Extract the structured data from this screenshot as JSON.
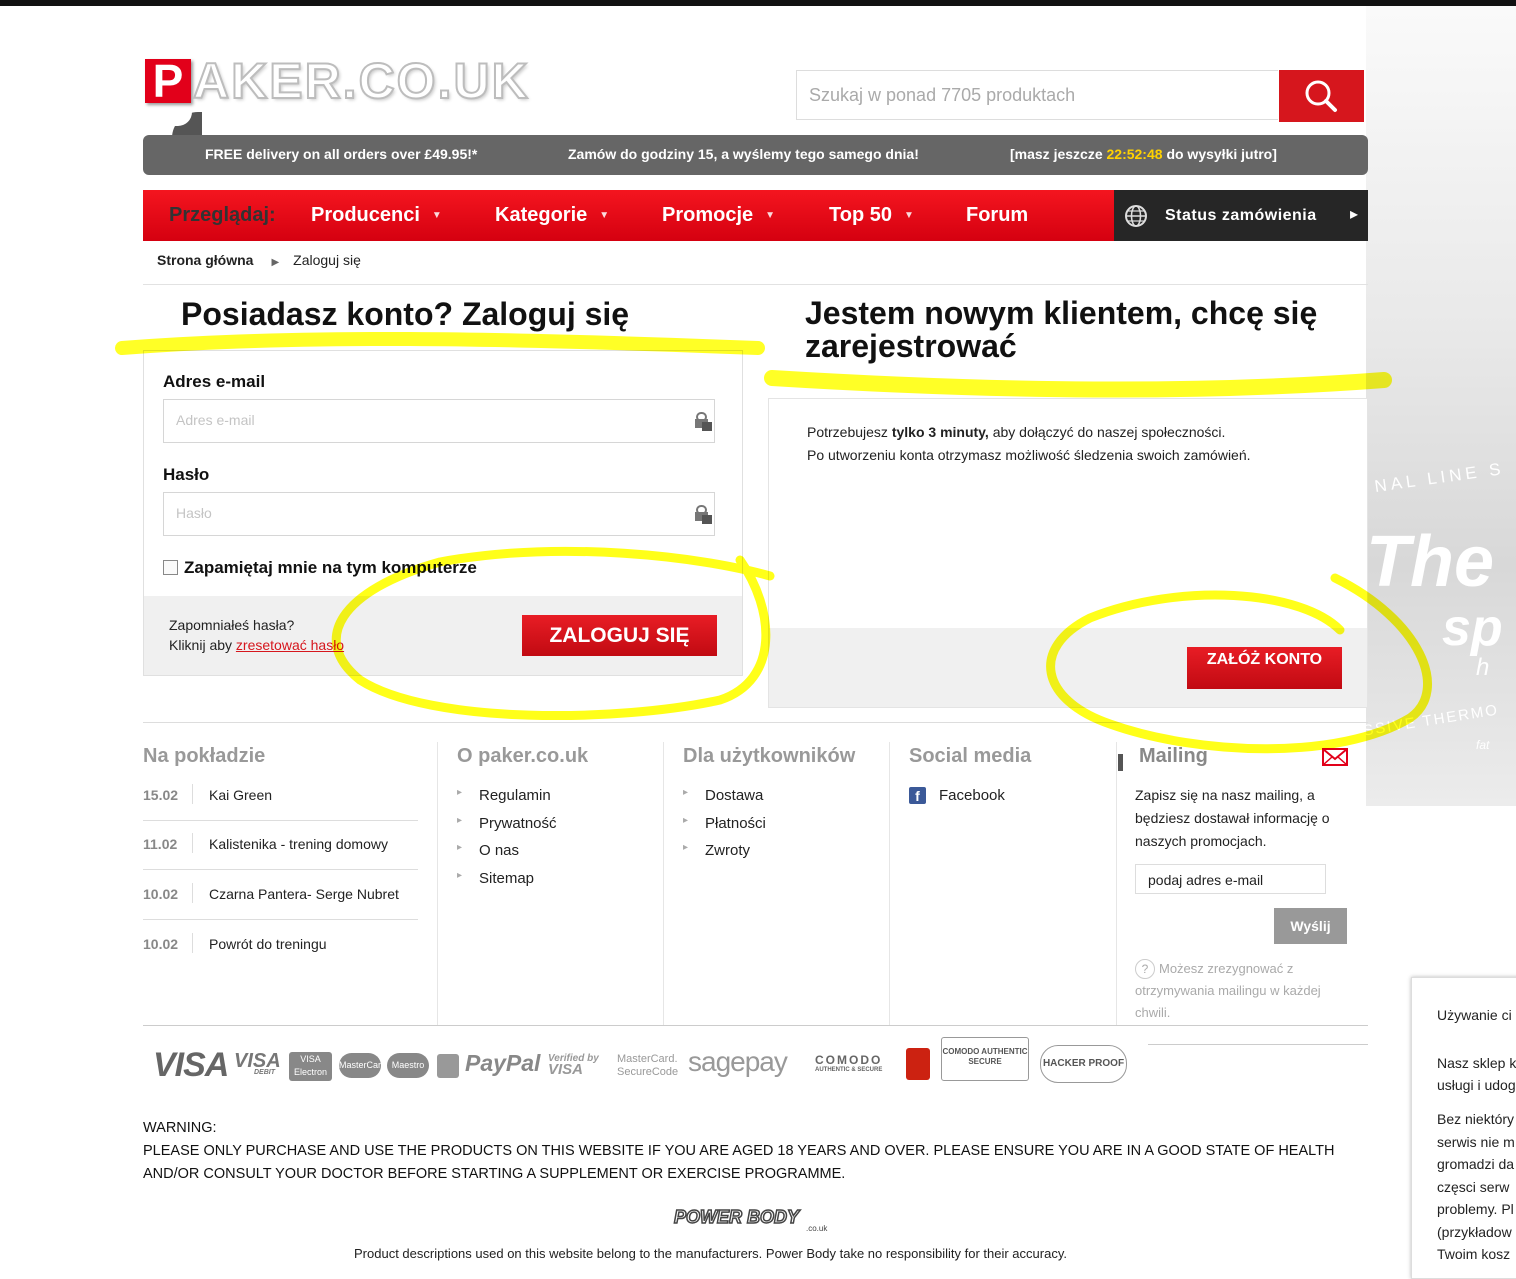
{
  "brand": {
    "logo_initial": "P",
    "logo_rest": "AKER.CO.UK"
  },
  "search": {
    "placeholder": "Szukaj w ponad 7705 produktach",
    "button_icon": "search-icon"
  },
  "infobar": {
    "delivery": "FREE delivery on all orders over £49.95!*",
    "same_day": "Zamów do godziny 15, a wyślemy tego samego dnia!",
    "countdown_prefix": "[masz jeszcze",
    "countdown": "22:52:48",
    "countdown_suffix": "do wysyłki jutro]"
  },
  "nav": {
    "browse": "Przeglądaj:",
    "items": [
      "Producenci",
      "Kategorie",
      "Promocje",
      "Top 50",
      "Forum"
    ],
    "status_label": "Status zamówienia",
    "colors": {
      "nav_red": "#e2001a",
      "status_bg": "#262626"
    }
  },
  "breadcrumb": {
    "home": "Strona główna",
    "current": "Zaloguj się"
  },
  "login": {
    "heading": "Posiadasz konto? Zaloguj się",
    "email_label": "Adres e-mail",
    "email_placeholder": "Adres e-mail",
    "password_label": "Hasło",
    "password_placeholder": "Hasło",
    "remember": "Zapamiętaj mnie na tym komputerze",
    "forgot_line1": "Zapomniałeś hasła?",
    "forgot_line2_prefix": "Kliknij aby",
    "forgot_link": "zresetować hasło",
    "submit": "ZALOGUJ SIĘ"
  },
  "register": {
    "heading": "Jestem nowym klientem, chcę się zarejestrować",
    "line1_prefix": "Potrzebujesz",
    "line1_bold": "tylko 3 minuty,",
    "line1_suffix": "aby dołączyć do naszej społeczności.",
    "line2": "Po utworzeniu konta otrzymasz możliwość śledzenia swoich zamówień.",
    "submit": "ZAŁÓŻ KONTO"
  },
  "footer": {
    "col1": {
      "title": "Na pokładzie",
      "news": [
        {
          "date": "15.02",
          "title": "Kai Green"
        },
        {
          "date": "11.02",
          "title": "Kalistenika - trening domowy"
        },
        {
          "date": "10.02",
          "title": "Czarna Pantera- Serge Nubret"
        },
        {
          "date": "10.02",
          "title": "Powrót do treningu"
        }
      ]
    },
    "col2": {
      "title": "O paker.co.uk",
      "links": [
        "Regulamin",
        "Prywatność",
        "O nas",
        "Sitemap"
      ]
    },
    "col3": {
      "title": "Dla użytkowników",
      "links": [
        "Dostawa",
        "Płatności",
        "Zwroty"
      ]
    },
    "col4": {
      "title": "Social media",
      "links": [
        "Facebook"
      ]
    },
    "mailing": {
      "title": "Mailing",
      "text": "Zapisz się na nasz mailing, a będziesz dostawał informację o naszych promocjach.",
      "input_value": "podaj adres e-mail",
      "send": "Wyślij",
      "note": "Możesz zrezygnować z otrzymywania mailingu w każdej chwili."
    }
  },
  "payments": {
    "visa": "VISA",
    "visa_debit": "VISA",
    "visa_debit_sub": "DEBIT",
    "visa_electron": "VISA Electron",
    "mastercard": "MasterCard",
    "maestro": "Maestro",
    "paypal": "PayPal",
    "verified_by": "Verified by",
    "verified_visa": "VISA",
    "mc_secure": "MasterCard. SecureCode",
    "sagepay": "sagepay",
    "comodo": "COMODO",
    "comodo_sub": "AUTHENTIC & SECURE",
    "comodo_badge": "COMODO AUTHENTIC SECURE",
    "hacker_proof": "HACKER PROOF"
  },
  "warning": {
    "label": "WARNING:",
    "text": "PLEASE ONLY PURCHASE AND USE THE PRODUCTS ON THIS WEBSITE IF YOU ARE AGED 18 YEARS AND OVER. PLEASE ENSURE YOU ARE IN A GOOD STATE OF HEALTH AND/OR CONSULT YOUR DOCTOR BEFORE STARTING A SUPPLEMENT OR EXERCISE PROGRAMME."
  },
  "powerbody": {
    "logo": "POWER BODY",
    "sub": ".co.uk"
  },
  "disclaimer": "Product descriptions used on this website belong to the manufacturers. Power Body take no responsibility for their accuracy.",
  "cookie": {
    "line1": "Używanie ci",
    "line2": "Nasz sklep k",
    "line3": "usługi i udog",
    "line4": "Bez niektóry",
    "line5": "serwis nie m",
    "line6": "gromadzi da",
    "line7": "częsci serw",
    "line8": "problemy. Pl",
    "line9": "(przykładow",
    "line10": "Twoim kosz"
  },
  "background_art": {
    "line1": "NAL LINE S",
    "line2": "The",
    "line3": "sp",
    "line4": "h",
    "line5": "PROGRESSIVE THERMO",
    "line6": "fat"
  },
  "highlight_color": "#ffff00"
}
